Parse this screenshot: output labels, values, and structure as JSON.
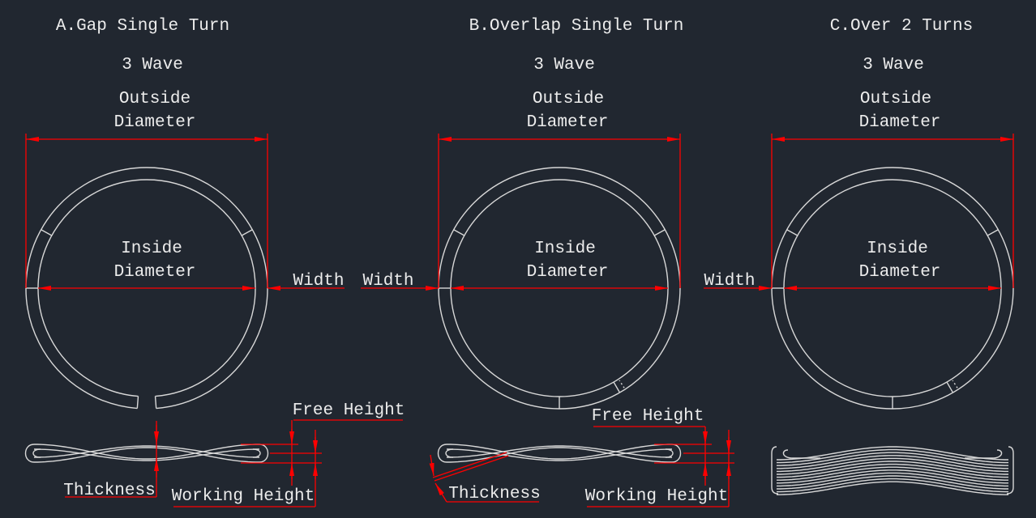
{
  "colors": {
    "background": "#212730",
    "drawing": "#d8d8d8",
    "dimension": "#ff0000"
  },
  "panels": [
    {
      "title": "A.Gap Single Turn",
      "wave": "3 Wave",
      "outside": [
        "Outside",
        "Diameter"
      ],
      "inside": [
        "Inside",
        "Diameter"
      ],
      "width": "Width",
      "free_height": "Free Height",
      "working_height": "Working Height",
      "thickness": "Thickness"
    },
    {
      "title": "B.Overlap Single Turn",
      "wave": "3 Wave",
      "outside": [
        "Outside",
        "Diameter"
      ],
      "inside": [
        "Inside",
        "Diameter"
      ],
      "width": "Width",
      "free_height": "Free Height",
      "working_height": "Working Height",
      "thickness": "Thickness"
    },
    {
      "title": "C.Over 2 Turns",
      "wave": "3 Wave",
      "outside": [
        "Outside",
        "Diameter"
      ],
      "inside": [
        "Inside",
        "Diameter"
      ],
      "width": "Width"
    }
  ]
}
